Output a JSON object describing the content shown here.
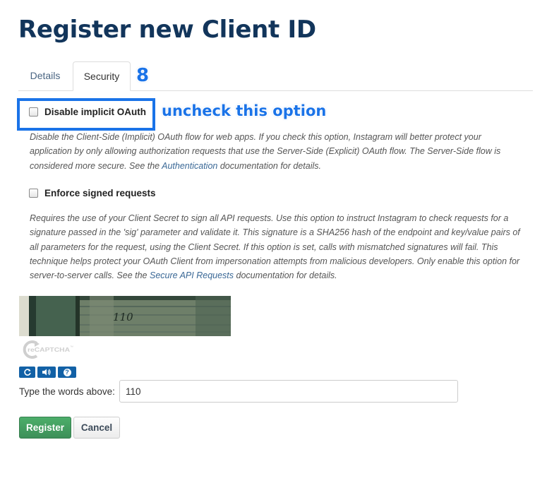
{
  "page": {
    "title": "Register new Client ID"
  },
  "tabs": [
    {
      "label": "Details",
      "active": false
    },
    {
      "label": "Security",
      "active": true
    }
  ],
  "annotation": {
    "step_number": "8",
    "text": "uncheck this option",
    "color": "#1a73e8"
  },
  "options": {
    "implicit": {
      "label": "Disable implicit OAuth",
      "checked": false,
      "desc_before": "Disable the Client-Side (Implicit) OAuth flow for web apps. If you check this option, Instagram will better protect your application by only allowing authorization requests that use the Server-Side (Explicit) OAuth flow. The Server-Side flow is considered more secure. See the ",
      "link": "Authentication",
      "desc_after": " documentation for details."
    },
    "signed": {
      "label": "Enforce signed requests",
      "checked": false,
      "desc_before": "Requires the use of your Client Secret to sign all API requests. Use this option to instruct Instagram to check requests for a signature passed in the 'sig' parameter and validate it. This signature is a SHA256 hash of the endpoint and key/value pairs of all parameters for the request, using the Client Secret. If this option is set, calls with mismatched signatures will fail. This technique helps protect your OAuth Client from impersonation attempts from malicious developers. Only enable this option for server-to-server calls. See the ",
      "link": "Secure API Requests",
      "desc_after": " documentation for details."
    }
  },
  "captcha": {
    "image_text": "110",
    "logo_text": "reCAPTCHA",
    "tm": "™",
    "buttons": [
      {
        "icon": "refresh-icon"
      },
      {
        "icon": "audio-icon"
      },
      {
        "icon": "help-icon",
        "glyph": "?"
      }
    ]
  },
  "form": {
    "label": "Type the words above:",
    "value": "110"
  },
  "actions": {
    "register": "Register",
    "cancel": "Cancel"
  }
}
